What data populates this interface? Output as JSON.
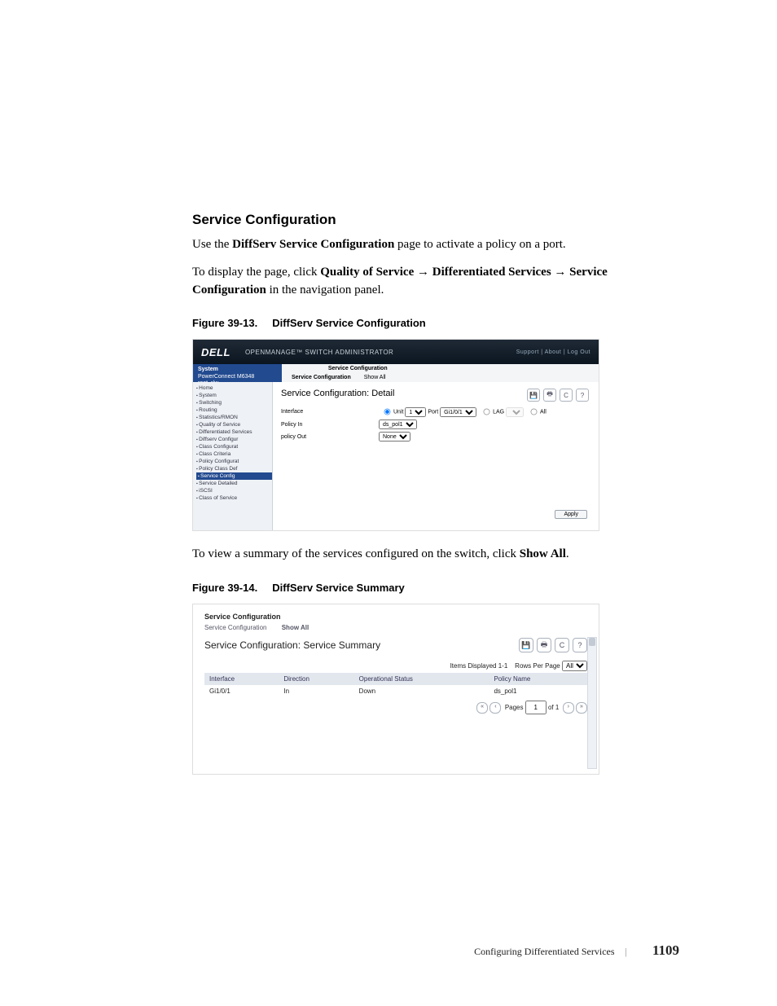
{
  "section_heading": "Service Configuration",
  "para1_pre": "Use the ",
  "para1_bold": "DiffServ Service Configuration",
  "para1_post": " page to activate a policy on a port.",
  "para2_pre": "To display the page, click ",
  "para2_b1": "Quality of Service",
  "para2_arrow": " → ",
  "para2_b2": "Differentiated Services",
  "para2_b3": "Service Configuration",
  "para2_post": " in the navigation panel.",
  "fig1_caption_a": "Figure 39-13.",
  "fig1_caption_b": "DiffServ Service Configuration",
  "fig2_caption_a": "Figure 39-14.",
  "fig2_caption_b": "DiffServ Service Summary",
  "between_text_pre": "To view a summary of the services configured on the switch, click ",
  "between_text_bold": "Show All",
  "between_text_post": ".",
  "shot1": {
    "logo": "DELL",
    "product": "OPENMANAGE™ SWITCH ADMINISTRATOR",
    "toplinks": "Support  |  About  |  Log Out",
    "left_title": "System",
    "left_sub1": "PowerConnect M6348",
    "left_sub2": "root, r/w",
    "tab_main": "Service Configuration",
    "subtab1": "Service Configuration",
    "subtab2": "Show All",
    "nav": [
      "Home",
      "System",
      "Switching",
      "Routing",
      "Statistics/RMON",
      "Quality of Service",
      "Differentiated Services",
      "Diffserv Configur",
      "Class Configurat",
      "Class Criteria",
      "Policy Configurat",
      "Policy Class Def",
      "Service Config",
      "Service Detailed",
      "iSCSI",
      "Class of Service"
    ],
    "nav_selected_index": 12,
    "panel_title": "Service Configuration: Detail",
    "row_interface": "Interface",
    "row_interface_unit": "Unit",
    "row_interface_unit_val": "1",
    "row_interface_port": "Port",
    "row_interface_port_val": "Gi1/0/1",
    "row_interface_lag": "LAG",
    "row_interface_all": "All",
    "row_policy_in": "Policy In",
    "row_policy_in_val": "ds_pol1",
    "row_policy_out": "policy Out",
    "row_policy_out_val": "None",
    "apply": "Apply"
  },
  "shot2": {
    "tab_main": "Service Configuration",
    "subtab1": "Service Configuration",
    "subtab2": "Show All",
    "panel_title": "Service Configuration: Service Summary",
    "items_displayed": "Items Displayed 1-1",
    "rows_per_page_label": "Rows Per Page",
    "rows_per_page_val": "All",
    "cols": [
      "Interface",
      "Direction",
      "Operational Status",
      "Policy Name"
    ],
    "row": [
      "Gi1/0/1",
      "In",
      "Down",
      "ds_pol1"
    ],
    "pager_pages": "Pages",
    "pager_page": "1",
    "pager_of": "of 1"
  },
  "footer_chapter": "Configuring Differentiated Services",
  "footer_page": "1109"
}
